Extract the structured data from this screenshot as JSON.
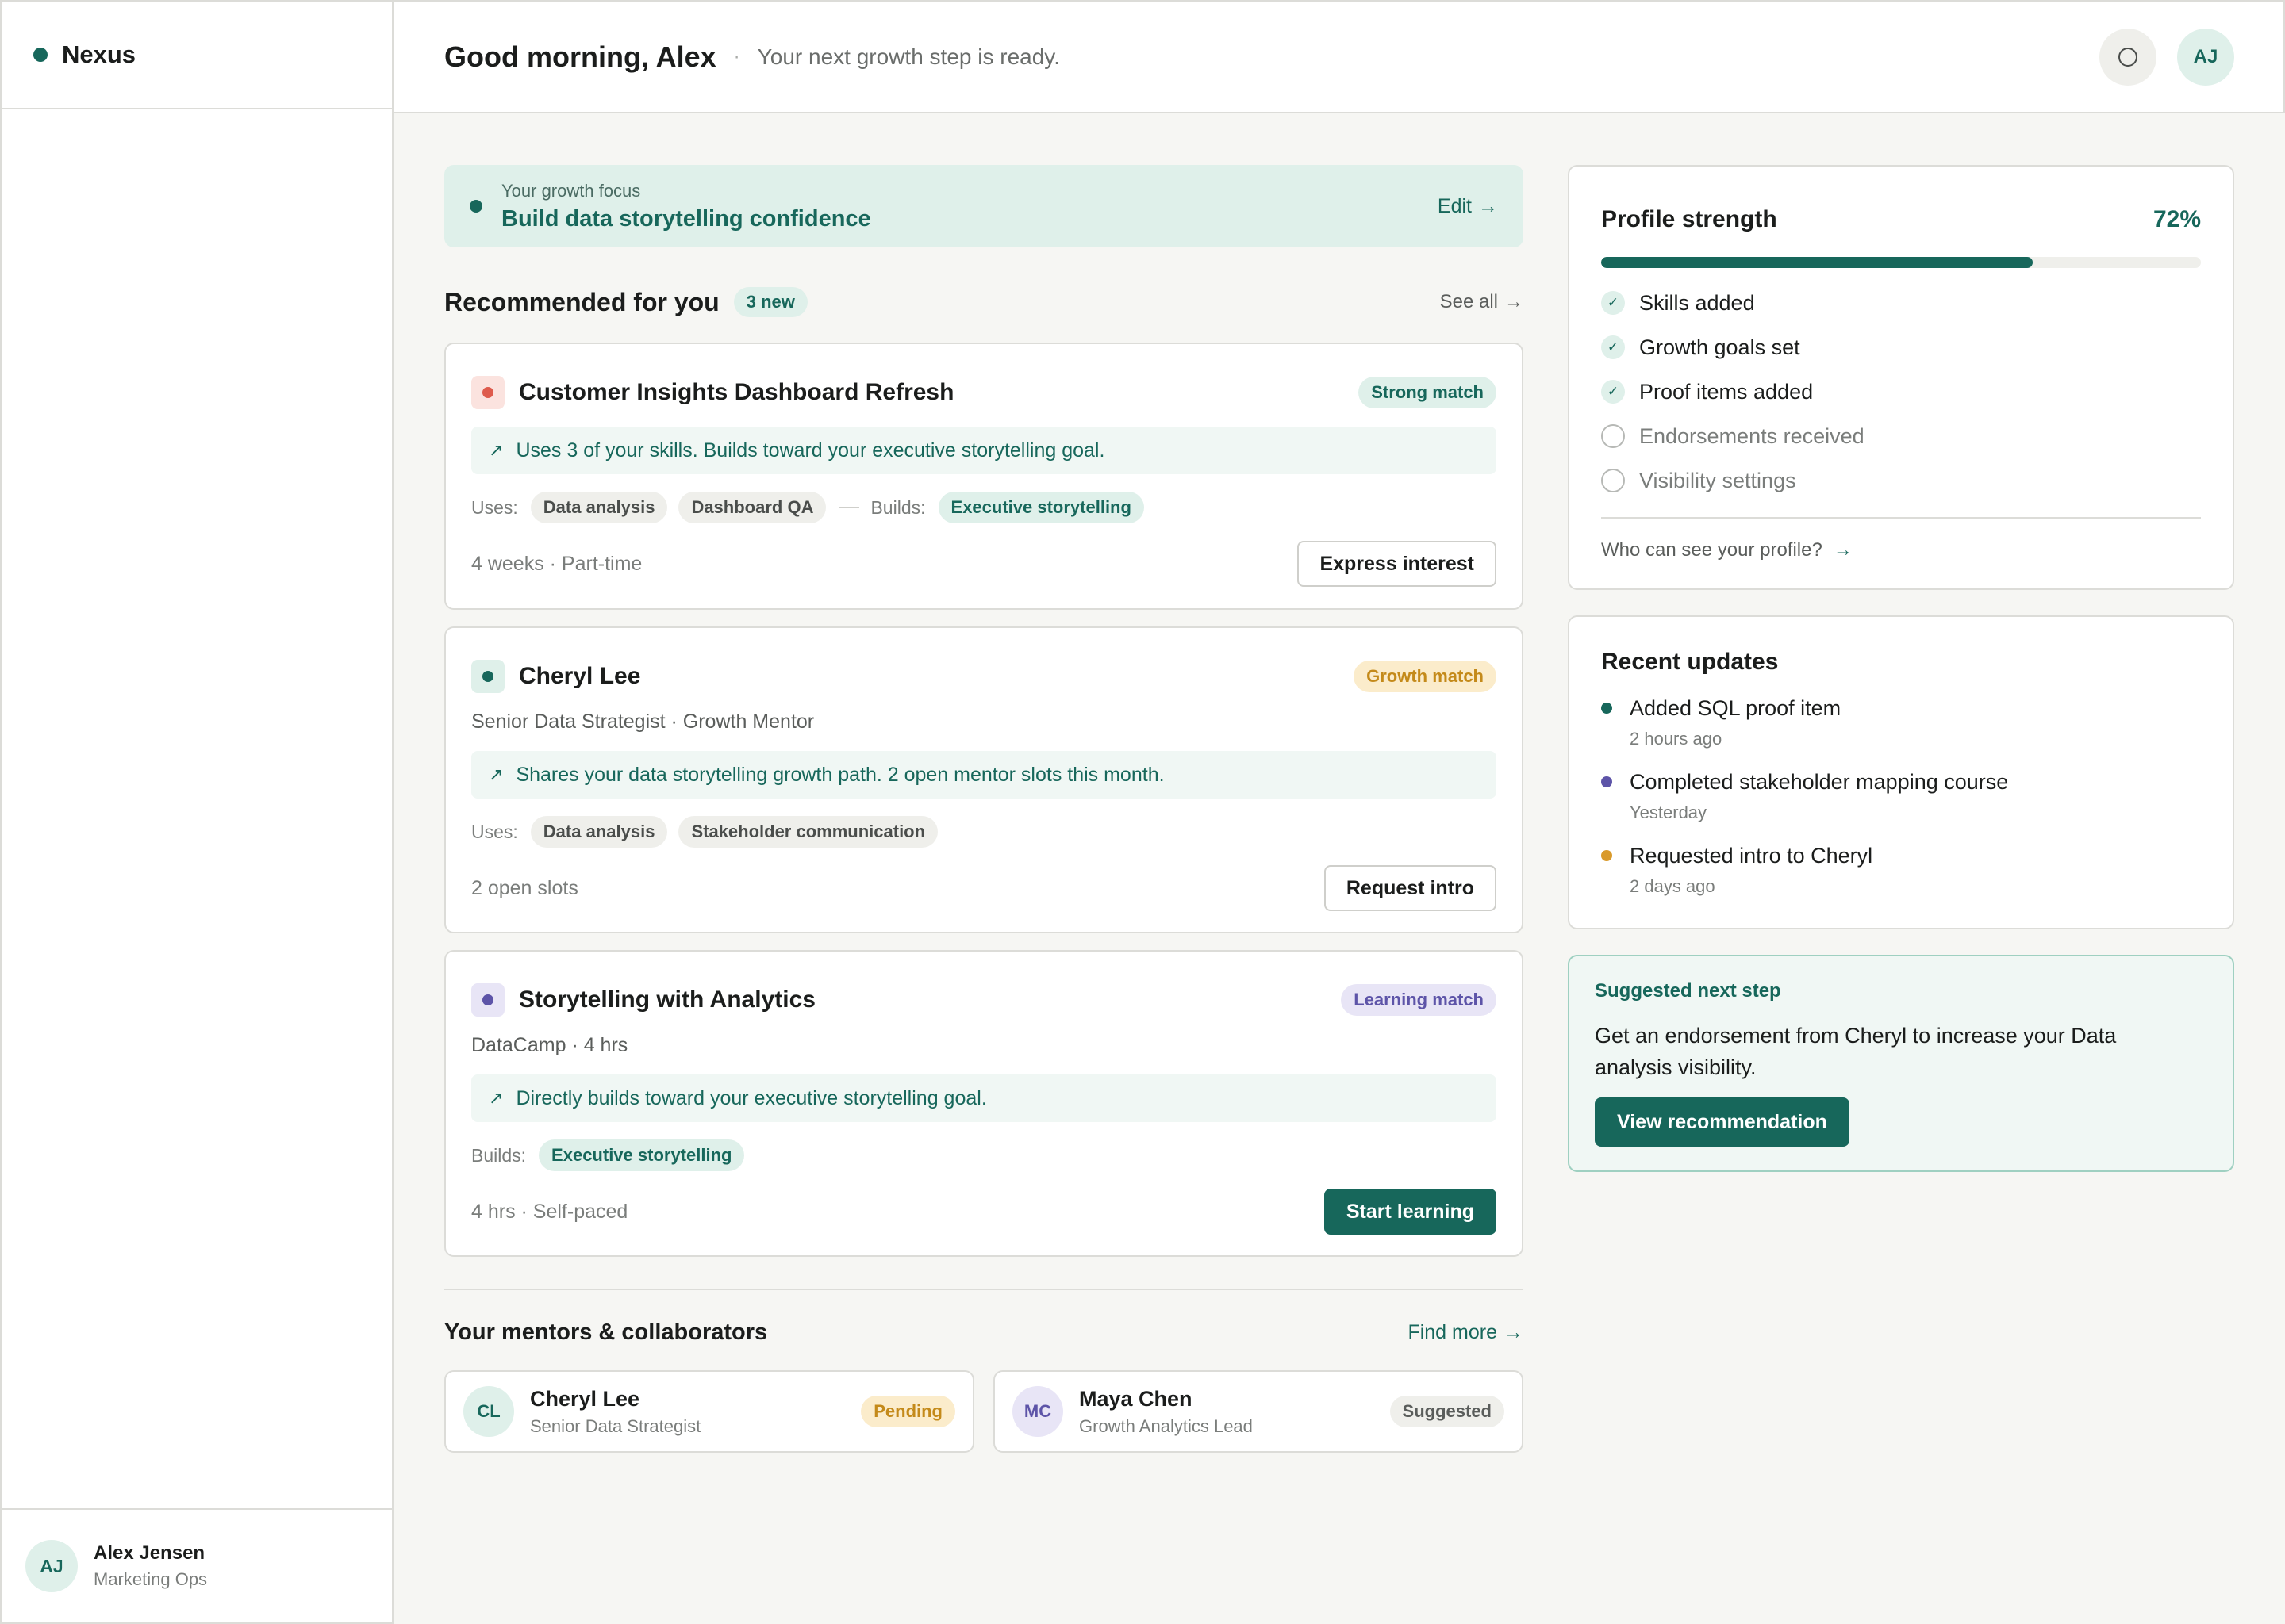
{
  "brand": {
    "name": "Nexus",
    "color": "#17675b"
  },
  "sidebar": {
    "user": {
      "initials": "AJ",
      "name": "Alex Jensen",
      "role": "Marketing Ops"
    }
  },
  "header": {
    "greeting": "Good morning, Alex",
    "separator": "·",
    "subtitle": "Your next growth step is ready.",
    "avatar_initials": "AJ",
    "notification_icon": "circle-icon"
  },
  "focus": {
    "label": "Your growth focus",
    "title": "Build data storytelling confidence",
    "edit_label": "Edit",
    "arrow": "→"
  },
  "recommended": {
    "title": "Recommended for you",
    "badge": "3 new",
    "see_all": "See all",
    "arrow": "→",
    "cards": [
      {
        "title": "Customer Insights Dashboard Refresh",
        "match": "Strong match",
        "reason_arrow": "↗",
        "reason": "Uses 3 of your skills. Builds toward your executive storytelling goal.",
        "uses_label": "Uses:",
        "uses": [
          "Data analysis",
          "Dashboard QA"
        ],
        "builds_label": "Builds:",
        "builds": [
          "Executive storytelling"
        ],
        "meta": "4 weeks · Part-time",
        "action": "Express interest"
      },
      {
        "title": "Cheryl Lee",
        "match": "Growth match",
        "subtitle": "Senior Data Strategist · Growth Mentor",
        "reason_arrow": "↗",
        "reason": "Shares your data storytelling growth path. 2 open mentor slots this month.",
        "uses_label": "Uses:",
        "uses": [
          "Data analysis",
          "Stakeholder communication"
        ],
        "meta": "2 open slots",
        "action": "Request intro"
      },
      {
        "title": "Storytelling with Analytics",
        "match": "Learning match",
        "subtitle": "DataCamp · 4 hrs",
        "reason_arrow": "↗",
        "reason": "Directly builds toward your executive storytelling goal.",
        "builds_label": "Builds:",
        "builds": [
          "Executive storytelling"
        ],
        "meta": "4 hrs · Self-paced",
        "action": "Start learning"
      }
    ]
  },
  "mentors": {
    "title": "Your mentors & collaborators",
    "find_more": "Find more",
    "arrow": "→",
    "items": [
      {
        "initials": "CL",
        "name": "Cheryl Lee",
        "role": "Senior Data Strategist",
        "status": "Pending"
      },
      {
        "initials": "MC",
        "name": "Maya Chen",
        "role": "Growth Analytics Lead",
        "status": "Suggested"
      }
    ]
  },
  "profile_strength": {
    "title": "Profile strength",
    "percent_label": "72%",
    "percent": 72,
    "items": [
      {
        "label": "Skills added",
        "done": true
      },
      {
        "label": "Growth goals set",
        "done": true
      },
      {
        "label": "Proof items added",
        "done": true
      },
      {
        "label": "Endorsements received",
        "done": false
      },
      {
        "label": "Visibility settings",
        "done": false
      }
    ],
    "check_glyph": "✓",
    "link": "Who can see your profile?",
    "arrow": "→"
  },
  "recent_updates": {
    "title": "Recent updates",
    "items": [
      {
        "title": "Added SQL proof item",
        "time": "2 hours ago",
        "color": "#17675b"
      },
      {
        "title": "Completed stakeholder mapping course",
        "time": "Yesterday",
        "color": "#5d54a8"
      },
      {
        "title": "Requested intro to Cheryl",
        "time": "2 days ago",
        "color": "#d99a2b"
      }
    ]
  },
  "next_step": {
    "label": "Suggested next step",
    "text": "Get an endorsement from Cheryl to increase your Data analysis visibility.",
    "action": "View recommendation"
  }
}
